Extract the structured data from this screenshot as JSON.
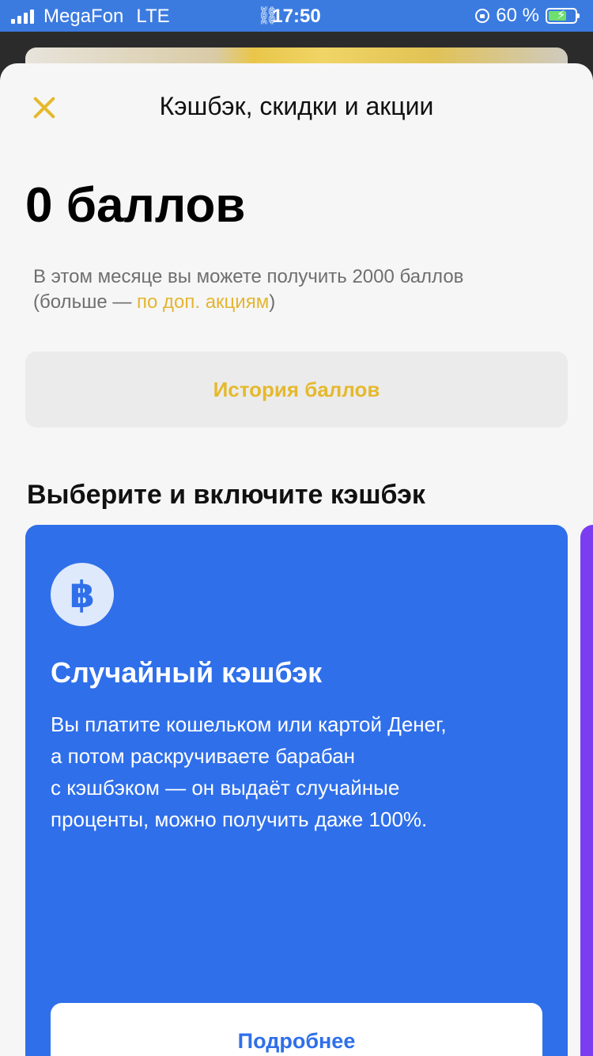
{
  "status_bar": {
    "carrier": "MegaFon",
    "network": "LTE",
    "time": "17:50",
    "battery_percent": "60 %",
    "battery_level": 0.6,
    "colors": {
      "bar": "#3b7be0",
      "battery_fill": "#6fe06f"
    }
  },
  "sheet": {
    "title": "Кэшбэк, скидки и акции",
    "points": "0 баллов",
    "description_prefix": "В этом месяце вы можете получить 2000 баллов (больше — ",
    "description_link": "по доп. акциям",
    "description_suffix": ")",
    "history_button": "История баллов",
    "section_title": "Выберите и включите кэшбэк"
  },
  "card": {
    "icon": "baht-icon",
    "icon_glyph": "฿",
    "title": "Случайный кэшбэк",
    "text": "Вы платите кошельком или картой Денег,\nа потом раскручиваете барабан\nс кэшбэком — он выдаёт случайные\nпроценты, можно получить даже 100%.",
    "button": "Подробнее",
    "color": "#2f6fea"
  },
  "colors": {
    "accent": "#e5b92d",
    "next_card": "#7b3df0"
  }
}
